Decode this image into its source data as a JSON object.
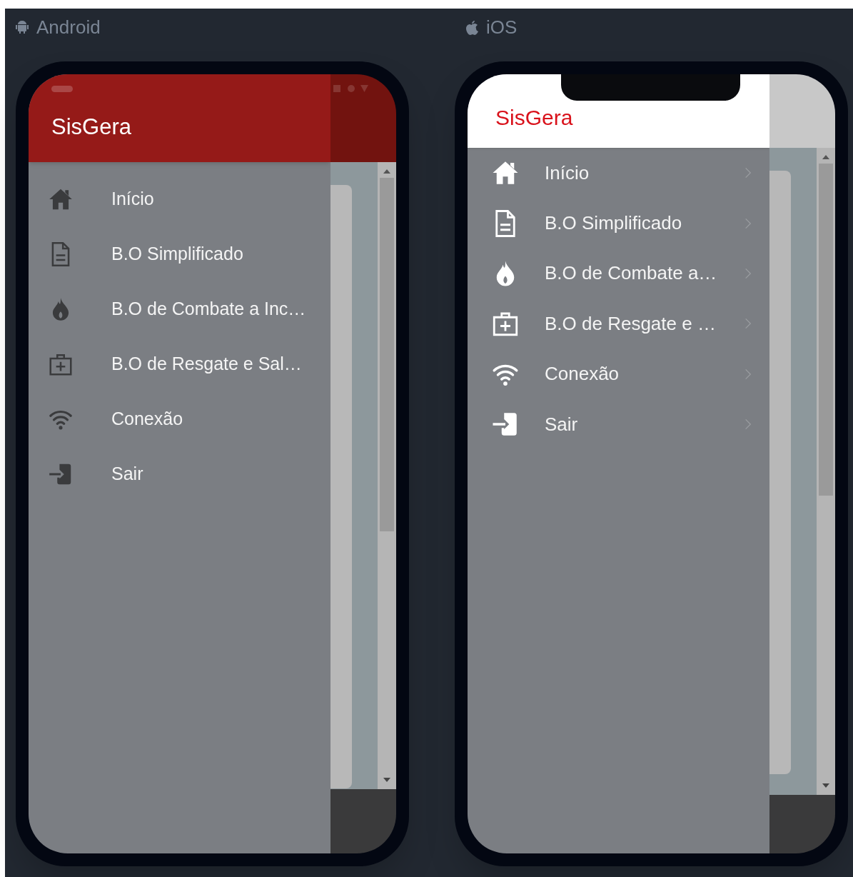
{
  "platforms": [
    {
      "kind": "android",
      "label": "Android",
      "app_title": "SisGera",
      "menu": [
        {
          "kind": "home",
          "label": "Início"
        },
        {
          "kind": "document",
          "label": "B.O Simplificado"
        },
        {
          "kind": "flame",
          "label": "B.O de Combate a Inc…"
        },
        {
          "kind": "medkit",
          "label": "B.O de Resgate e Sal…"
        },
        {
          "kind": "wifi",
          "label": "Conexão"
        },
        {
          "kind": "exit",
          "label": "Sair"
        }
      ]
    },
    {
      "kind": "ios",
      "label": "iOS",
      "app_title": "SisGera",
      "menu": [
        {
          "kind": "home",
          "label": "Início"
        },
        {
          "kind": "document",
          "label": "B.O Simplificado"
        },
        {
          "kind": "flame",
          "label": "B.O de Combate a…"
        },
        {
          "kind": "medkit",
          "label": "B.O de Resgate e …"
        },
        {
          "kind": "wifi",
          "label": "Conexão"
        },
        {
          "kind": "exit",
          "label": "Sair"
        }
      ]
    }
  ]
}
